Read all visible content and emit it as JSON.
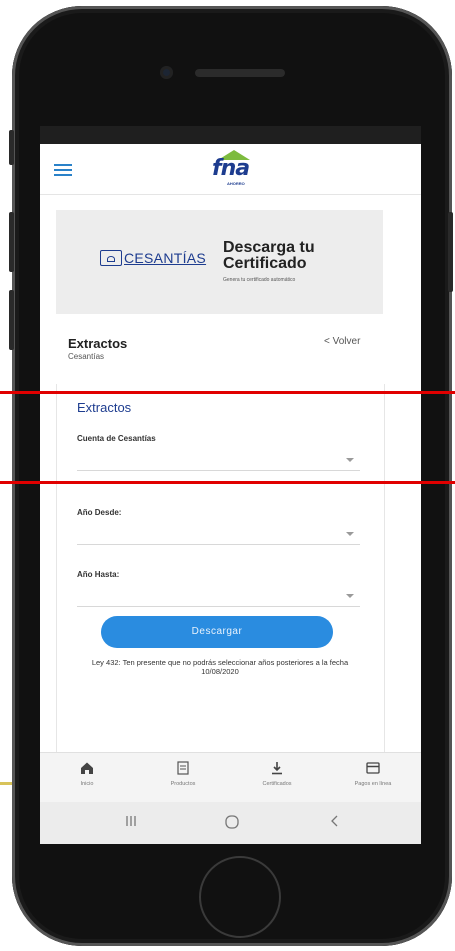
{
  "app": {
    "logo_text": "fna",
    "logo_sub": "AHORRO"
  },
  "banner": {
    "logo_text": "CESANTÍAS",
    "title": "Descarga tu Certificado",
    "subtitle": "Genera tu certificado automático"
  },
  "section": {
    "title": "Extractos",
    "subtitle": "Cesantías",
    "back_label": "< Volver"
  },
  "form": {
    "title": "Extractos",
    "fields": [
      {
        "label": "Cuenta de Cesantías",
        "value": ""
      },
      {
        "label": "Año Desde:",
        "value": ""
      },
      {
        "label": "Año Hasta:",
        "value": ""
      }
    ],
    "submit_label": "Descargar",
    "note": "Ley 432: Ten presente que no podrás seleccionar años posteriores a la fecha",
    "note_date": "10/08/2020"
  },
  "tabbar": {
    "items": [
      {
        "label": "Inicio",
        "icon": "home-icon"
      },
      {
        "label": "Productos",
        "icon": "document-icon"
      },
      {
        "label": "Certificados",
        "icon": "download-icon"
      },
      {
        "label": "Pagos en línea",
        "icon": "card-icon"
      }
    ]
  },
  "colors": {
    "brand_blue": "#1d3c8f",
    "accent_blue": "#2a8ce0",
    "brand_green": "#7dbb3e",
    "annotation_red": "#e10000"
  }
}
